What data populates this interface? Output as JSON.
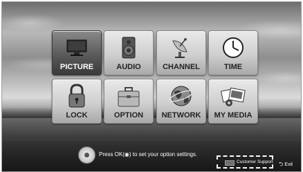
{
  "menu": {
    "tiles": [
      {
        "label": "PICTURE",
        "icon": "tv-icon",
        "selected": true
      },
      {
        "label": "AUDIO",
        "icon": "speaker-icon",
        "selected": false
      },
      {
        "label": "CHANNEL",
        "icon": "satellite-dish-icon",
        "selected": false
      },
      {
        "label": "TIME",
        "icon": "clock-icon",
        "selected": false
      },
      {
        "label": "LOCK",
        "icon": "padlock-icon",
        "selected": false
      },
      {
        "label": "OPTION",
        "icon": "toolbox-icon",
        "selected": false
      },
      {
        "label": "NETWORK",
        "icon": "globe-icon",
        "selected": false
      },
      {
        "label": "MY MEDIA",
        "icon": "photos-icon",
        "selected": false
      }
    ]
  },
  "footer": {
    "hint_text": "Press OK(◉) to set your option settings.",
    "customer_support_label": "Customer Support",
    "exit_label": "Exit"
  }
}
